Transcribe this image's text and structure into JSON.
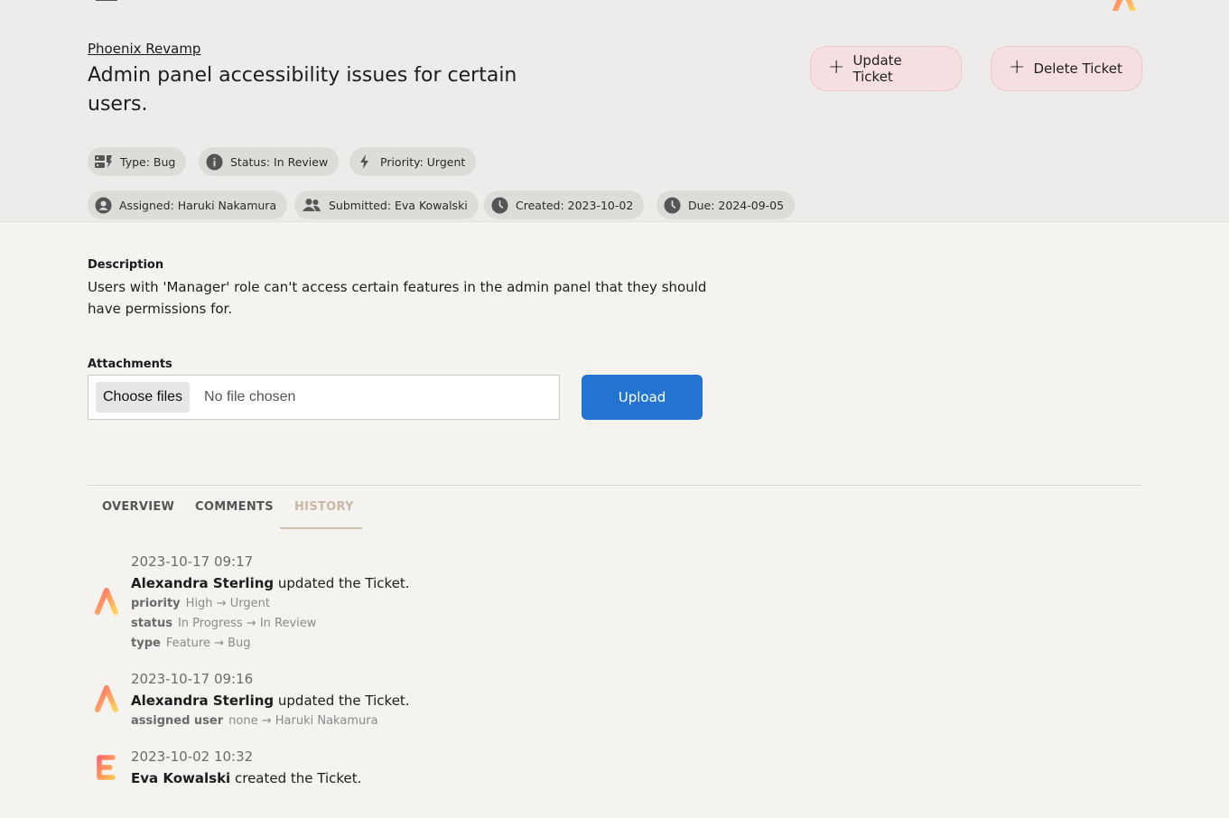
{
  "project": {
    "name": "Phoenix Revamp"
  },
  "ticket": {
    "title": "Admin panel accessibility issues for certain users.",
    "chips": {
      "type": "Type: Bug",
      "status": "Status: In Review",
      "priority": "Priority: Urgent",
      "assigned": "Assigned: Haruki Nakamura",
      "submitted": "Submitted: Eva Kowalski",
      "created": "Created: 2023-10-02",
      "due": "Due: 2024-09-05"
    }
  },
  "actions": {
    "update": "Update Ticket",
    "delete": "Delete Ticket"
  },
  "description": {
    "label": "Description",
    "text": "Users with 'Manager' role can't access certain features in the admin panel that they should have permissions for."
  },
  "attachments": {
    "label": "Attachments",
    "choose": "Choose files",
    "no_file": "No file chosen",
    "upload": "Upload"
  },
  "tabs": [
    {
      "label": "OVERVIEW",
      "active": false
    },
    {
      "label": "COMMENTS",
      "active": false
    },
    {
      "label": "HISTORY",
      "active": true
    }
  ],
  "history": [
    {
      "time": "2023-10-17 09:17",
      "user": "Alexandra Sterling",
      "action": "updated the Ticket.",
      "avatar_letter": "A",
      "changes": [
        {
          "field": "priority",
          "from": "High",
          "to": "Urgent"
        },
        {
          "field": "status",
          "from": "In Progress",
          "to": "In Review"
        },
        {
          "field": "type",
          "from": "Feature",
          "to": "Bug"
        }
      ]
    },
    {
      "time": "2023-10-17 09:16",
      "user": "Alexandra Sterling",
      "action": "updated the Ticket.",
      "avatar_letter": "A",
      "changes": [
        {
          "field": "assigned user",
          "from": "none",
          "to": "Haruki Nakamura"
        }
      ]
    },
    {
      "time": "2023-10-02 10:32",
      "user": "Eva Kowalski",
      "action": "created the Ticket.",
      "avatar_letter": "E",
      "changes": []
    }
  ],
  "arrow": "→",
  "colors": {
    "accent": "#2374d0",
    "action_bg": "#f6dfe0",
    "active_tab": "#c8b9a7"
  }
}
